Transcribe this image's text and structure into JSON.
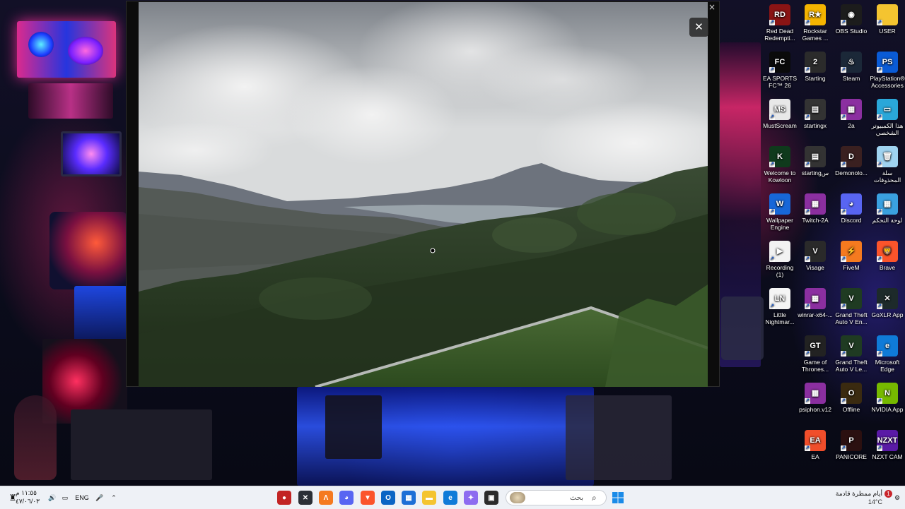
{
  "viewer": {
    "close_glyph": "✕",
    "mini_close_glyph": "×"
  },
  "desktop_icons": [
    {
      "label": "Red Dead Redempti...",
      "icon": "rdr-icon",
      "color": "#8a1414",
      "glyph": "RD"
    },
    {
      "label": "Rockstar Games ...",
      "icon": "rockstar-icon",
      "color": "#f5b400",
      "glyph": "R★"
    },
    {
      "label": "OBS Studio",
      "icon": "obs-icon",
      "color": "#1c1c1c",
      "glyph": "◉"
    },
    {
      "label": "USER",
      "icon": "folder-icon",
      "color": "#f4c430",
      "glyph": ""
    },
    {
      "label": "EA SPORTS FC™ 26",
      "icon": "fc26-icon",
      "color": "#0a0a0a",
      "glyph": "FC"
    },
    {
      "label": "Starting",
      "icon": "starting-icon",
      "color": "#2b2b2b",
      "glyph": "2"
    },
    {
      "label": "Steam",
      "icon": "steam-icon",
      "color": "#1b2838",
      "glyph": "♨"
    },
    {
      "label": "PlayStation® Accessories",
      "icon": "playstation-icon",
      "color": "#0a5bd6",
      "glyph": "PS"
    },
    {
      "label": "MustScream",
      "icon": "mustscream-icon",
      "color": "#e8e8e8",
      "glyph": "MS"
    },
    {
      "label": "startingx",
      "icon": "startingx-icon",
      "color": "#333",
      "glyph": "▤"
    },
    {
      "label": "2a",
      "icon": "winrar-icon",
      "color": "#8b2fa0",
      "glyph": "▦"
    },
    {
      "label": "هذا الكمبيوتر الشخصي",
      "icon": "this-pc-icon",
      "color": "#2aa7d9",
      "glyph": "▭"
    },
    {
      "label": "Welcome to Kowloon",
      "icon": "kowloon-icon",
      "color": "#0f3a1c",
      "glyph": "K"
    },
    {
      "label": "startingس",
      "icon": "startings-icon",
      "color": "#333",
      "glyph": "▤"
    },
    {
      "label": "Demonolo...",
      "icon": "demonologist-icon",
      "color": "#3a2020",
      "glyph": "D"
    },
    {
      "label": "سلة المحذوفات",
      "icon": "recycle-bin-icon",
      "color": "#9fd3f0",
      "glyph": "🗑"
    },
    {
      "label": "Wallpaper Engine",
      "icon": "wallpaper-engine-icon",
      "color": "#1767d8",
      "glyph": "W"
    },
    {
      "label": "Twitch-2A",
      "icon": "winrar-icon",
      "color": "#8b2fa0",
      "glyph": "▦"
    },
    {
      "label": "Discord",
      "icon": "discord-icon",
      "color": "#5865f2",
      "glyph": "◕"
    },
    {
      "label": "لوحة التحكم",
      "icon": "control-panel-icon",
      "color": "#3aa0e0",
      "glyph": "▦"
    },
    {
      "label": "Recording (1)",
      "icon": "video-file-icon",
      "color": "#f2f2f2",
      "glyph": "▶"
    },
    {
      "label": "Visage",
      "icon": "visage-icon",
      "color": "#2a2a2a",
      "glyph": "V"
    },
    {
      "label": "FiveM",
      "icon": "fivem-icon",
      "color": "#f57a1f",
      "glyph": "⚡"
    },
    {
      "label": "Brave",
      "icon": "brave-icon",
      "color": "#fb542b",
      "glyph": "🦁"
    },
    {
      "label": "Little Nightmar...",
      "icon": "little-nightmares-icon",
      "color": "#f5f5f5",
      "glyph": "LN"
    },
    {
      "label": "winrar-x64-...",
      "icon": "winrar-icon",
      "color": "#8b2fa0",
      "glyph": "▦"
    },
    {
      "label": "Grand Theft Auto V En...",
      "icon": "gta-icon",
      "color": "#1f3b22",
      "glyph": "V"
    },
    {
      "label": "GoXLR App",
      "icon": "goxlr-icon",
      "color": "#1d2a2a",
      "glyph": "✕"
    },
    {
      "label": "Game of Thrones...",
      "icon": "got-icon",
      "color": "#222",
      "glyph": "GT"
    },
    {
      "label": "Grand Theft Auto V Le...",
      "icon": "gta-icon",
      "color": "#1f3b22",
      "glyph": "V"
    },
    {
      "label": "Microsoft Edge",
      "icon": "edge-icon",
      "color": "#0f7bd8",
      "glyph": "e"
    },
    {
      "label": "psiphon.v12",
      "icon": "winrar-icon",
      "color": "#8b2fa0",
      "glyph": "▦"
    },
    {
      "label": "Offline",
      "icon": "offline-icon",
      "color": "#3a2a10",
      "glyph": "O"
    },
    {
      "label": "NVIDIA App",
      "icon": "nvidia-icon",
      "color": "#76b900",
      "glyph": "N"
    },
    {
      "label": "EA",
      "icon": "ea-icon",
      "color": "#f04e2b",
      "glyph": "EA"
    },
    {
      "label": "PANICORE",
      "icon": "panicore-icon",
      "color": "#2b1010",
      "glyph": "P"
    },
    {
      "label": "NZXT CAM",
      "icon": "nzxt-icon",
      "color": "#5a1aa6",
      "glyph": "NZXT"
    }
  ],
  "taskbar": {
    "search_placeholder": "بحث",
    "search_icon": "magnifier-icon",
    "weather_text": "أيام ممطرة قادمة",
    "temperature": "14°C",
    "notification_count": "1",
    "clock_time": "١١:٥٥ م",
    "clock_date": "٤٧/٠٦/٠٣",
    "language": "ENG",
    "pinned": [
      {
        "name": "app-red-icon",
        "color": "#c22424",
        "glyph": "●"
      },
      {
        "name": "terminal-icon",
        "color": "#2b2f36",
        "glyph": "✕"
      },
      {
        "name": "fivem-task-icon",
        "color": "#f57a1f",
        "glyph": "Λ"
      },
      {
        "name": "discord-task-icon",
        "color": "#5865f2",
        "glyph": "◕"
      },
      {
        "name": "brave-task-icon",
        "color": "#fb542b",
        "glyph": "▼"
      },
      {
        "name": "outlook-icon",
        "color": "#0a64c4",
        "glyph": "O"
      },
      {
        "name": "store-icon",
        "color": "#1d6fd6",
        "glyph": "▦"
      },
      {
        "name": "explorer-icon",
        "color": "#f4c430",
        "glyph": "▬"
      },
      {
        "name": "edge-task-icon",
        "color": "#0f7bd8",
        "glyph": "e"
      },
      {
        "name": "copilot-icon",
        "color": "#8d6cf0",
        "glyph": "✦"
      },
      {
        "name": "task-view-icon",
        "color": "#2b2b2b",
        "glyph": "▣"
      }
    ]
  }
}
